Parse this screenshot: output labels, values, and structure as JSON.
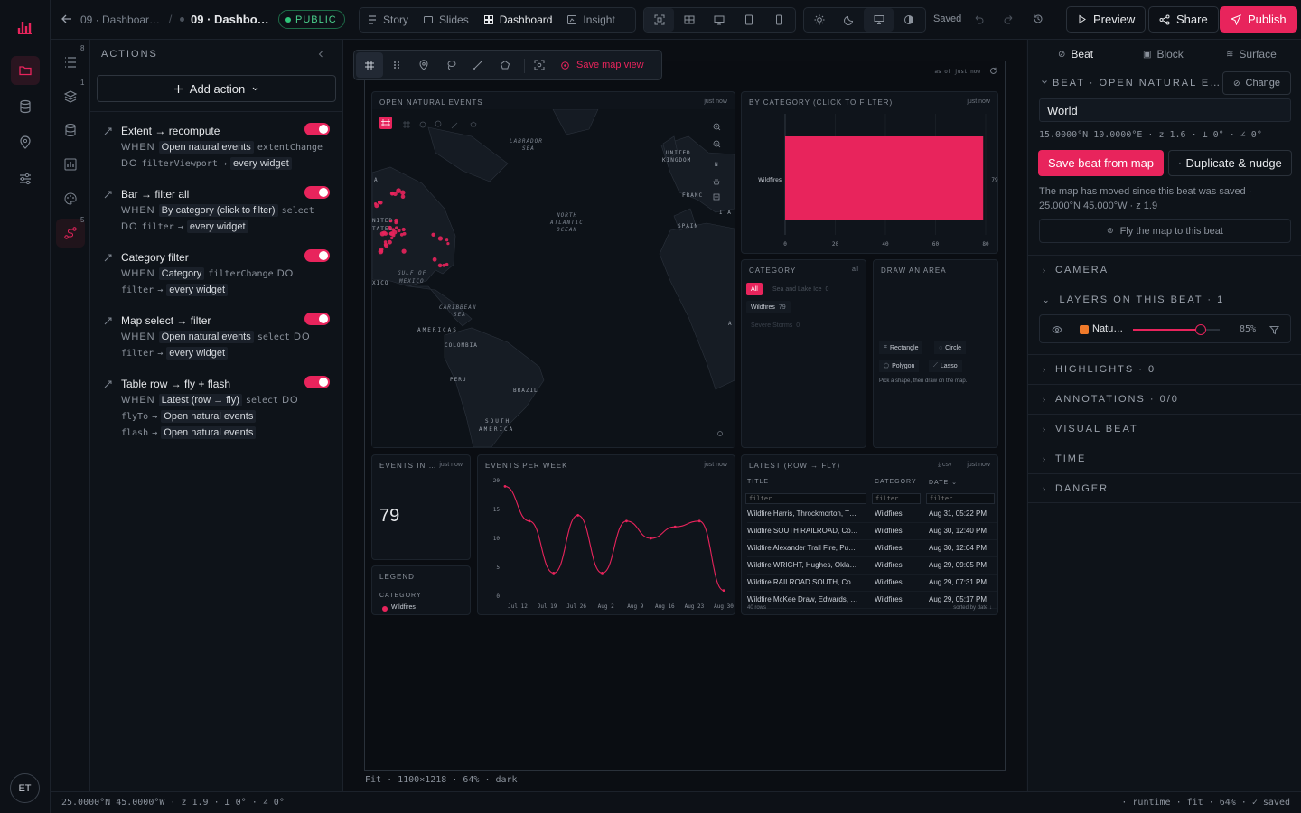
{
  "app": {
    "initials": "ET"
  },
  "rail": {
    "icons": [
      "logo-icon",
      "folder-icon",
      "database-icon",
      "location-pin-icon",
      "sliders-icon"
    ]
  },
  "topbar": {
    "breadcrumb_parent": "09 · Dashboar…",
    "breadcrumb_sep": "/",
    "breadcrumb_current": "09 · Dashbo…",
    "visibility": "PUBLIC",
    "views": [
      {
        "label": "Story"
      },
      {
        "label": "Slides"
      },
      {
        "label": "Dashboard"
      },
      {
        "label": "Insight"
      }
    ],
    "save_status": "Saved",
    "preview_label": "Preview",
    "share_label": "Share",
    "publish_label": "Publish"
  },
  "leftnav": {
    "counts": [
      "8",
      "1",
      "5"
    ]
  },
  "actions": {
    "title": "ACTIONS",
    "add_label": "Add action",
    "items": [
      {
        "title": "Extent → recompute",
        "when": "WHEN",
        "source": "Open natural events",
        "event": "extentChange",
        "do": "DO",
        "op": "filterViewport",
        "arrow": "→",
        "target": "every widget"
      },
      {
        "title": "Bar → filter all",
        "when": "WHEN",
        "source": "By category (click to filter)",
        "event": "select",
        "do": "DO",
        "op": "filter",
        "arrow": "→",
        "target": "every widget"
      },
      {
        "title": "Category filter",
        "when": "WHEN",
        "source": "Category",
        "event": "filterChange",
        "do": "DO",
        "op": "filter",
        "arrow": "→",
        "target": "every widget"
      },
      {
        "title": "Map select → filter",
        "when": "WHEN",
        "source": "Open natural events",
        "event": "select",
        "do": "DO",
        "op": "filter",
        "arrow": "→",
        "target": "every widget"
      },
      {
        "title": "Table row → fly + flash",
        "when": "WHEN",
        "source": "Latest (row → fly)",
        "event": "select",
        "do": "DO",
        "op": "flyTo",
        "arrow": "→",
        "target": "Open natural events",
        "op2": "flash",
        "target2": "Open natural events"
      }
    ]
  },
  "canvas": {
    "save_map_view": "Save map view",
    "frame_meta": "as of just now",
    "footer": "Fit · 1100×1218 · 64% · dark",
    "map": {
      "title": "OPEN NATURAL EVENTS",
      "updated": "just now",
      "labels": {
        "labrador": "LABRADOR",
        "sea": "SEA",
        "uk1": "UNITED",
        "uk2": "KINGDOM",
        "fran": "FRANC",
        "ita": "ITA",
        "spain": "SPAIN",
        "natl1": "NORTH",
        "natl2": "ATLANTIC",
        "natl3": "OCEAN",
        "us1": "NITED",
        "us2": "TATES",
        "mex": "XICO",
        "gulf1": "GULF OF",
        "gulf2": "MEXICO",
        "carib1": "CARIBBEAN",
        "carib2": "SEA",
        "americas": "AMERICAS",
        "colombia": "COLOMBIA",
        "peru": "PERU",
        "brazil": "BRAZIL",
        "sam1": "SOUTH",
        "sam2": "AMERICA",
        "n": "N",
        "a1": "A",
        "a2": "A"
      }
    },
    "bar": {
      "title": "BY CATEGORY (CLICK TO FILTER)",
      "updated": "just now"
    },
    "category": {
      "title": "CATEGORY",
      "all_link": "all",
      "chips": [
        {
          "label": "All"
        },
        {
          "label": "Sea and Lake Ice",
          "count": "0"
        },
        {
          "label": "Wildfires",
          "count": "79"
        },
        {
          "label": "Severe Storms",
          "count": "0"
        }
      ]
    },
    "draw": {
      "title": "DRAW AN AREA",
      "tools": [
        "Rectangle",
        "Circle",
        "Polygon",
        "Lasso"
      ],
      "hint": "Pick a shape, then draw on the map."
    },
    "events": {
      "title": "EVENTS IN …",
      "updated": "just now",
      "value": "79"
    },
    "legend": {
      "title": "LEGEND",
      "category_label": "CATEGORY",
      "item": "Wildfires"
    },
    "line": {
      "title": "EVENTS PER WEEK",
      "updated": "just now"
    },
    "table": {
      "title": "LATEST (ROW → FLY)",
      "csv": "csv",
      "updated": "just now",
      "headers": [
        "TITLE",
        "CATEGORY",
        "DATE ⌄"
      ],
      "filter_placeholder": "filter",
      "rows": [
        [
          "Wildfire Harris, Throckmorton, T…",
          "Wildfires",
          "Aug 31, 05:22 PM"
        ],
        [
          "Wildfire SOUTH RAILROAD, Co…",
          "Wildfires",
          "Aug 30, 12:40 PM"
        ],
        [
          "Wildfire Alexander Trail Fire, Pu…",
          "Wildfires",
          "Aug 30, 12:04 PM"
        ],
        [
          "Wildfire WRIGHT, Hughes, Okla…",
          "Wildfires",
          "Aug 29, 09:05 PM"
        ],
        [
          "Wildfire RAILROAD SOUTH, Co…",
          "Wildfires",
          "Aug 29, 07:31 PM"
        ],
        [
          "Wildfire McKee Draw, Edwards, …",
          "Wildfires",
          "Aug 29, 05:17 PM"
        ]
      ],
      "row_count": "40 rows",
      "sorted": "sorted by date ↓"
    }
  },
  "inspector": {
    "tabs": [
      {
        "label": "Beat"
      },
      {
        "label": "Block"
      },
      {
        "label": "Surface"
      }
    ],
    "beat_header": "BEAT · OPEN NATURAL E…",
    "change_label": "Change",
    "beat_name": "World",
    "coords": "15.0000°N 10.0000°E · z 1.6 · ⟂ 0° · ∠ 0°",
    "save_beat_label": "Save beat from map",
    "duplicate_label": "Duplicate & nudge",
    "moved_note": "The map has moved since this beat was saved · 25.000°N 45.000°W · z 1.9",
    "fly_label": "Fly the map to this beat",
    "sections": {
      "camera": "CAMERA",
      "layers": "LAYERS ON THIS BEAT · 1",
      "highlights": "HIGHLIGHTS · 0",
      "annotations": "ANNOTATIONS · 0/0",
      "visual": "VISUAL BEAT",
      "time": "TIME",
      "danger": "DANGER"
    },
    "layer": {
      "name": "Natu…",
      "opacity": "85%",
      "opacity_value": 0.78,
      "swatch": "#f07a2a"
    }
  },
  "statusbar": {
    "left": "25.0000°N 45.0000°W · z 1.9 · ⟂ 0° · ∠ 0°",
    "right": "· runtime · fit · 64% · ✓ saved"
  },
  "chart_data": [
    {
      "type": "bar",
      "categories": [
        "Wildfires"
      ],
      "values": [
        79
      ],
      "xlim": [
        0,
        80
      ],
      "xticks": [
        0,
        20,
        40,
        60,
        80
      ],
      "data_labels": [
        "79"
      ],
      "grid": true
    },
    {
      "type": "line",
      "x": [
        "Jul 12",
        "Jul 19",
        "Jul 26",
        "Aug 2",
        "Aug 9",
        "Aug 16",
        "Aug 23",
        "Aug 30"
      ],
      "values": [
        19,
        13,
        4,
        14,
        4,
        13,
        10,
        12,
        13,
        1
      ],
      "ylim": [
        0,
        20
      ],
      "yticks": [
        0,
        5,
        10,
        15,
        20
      ]
    }
  ],
  "colors": {
    "accent": "#e8245c",
    "bg": "#0c1016",
    "panel": "#0f141b"
  }
}
